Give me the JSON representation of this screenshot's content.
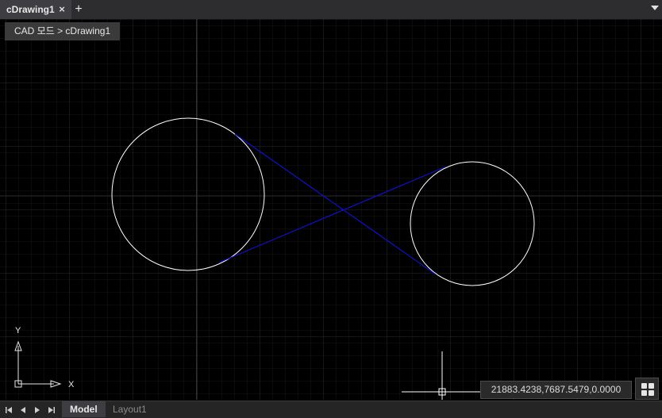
{
  "tab": {
    "title": "cDrawing1",
    "close_glyph": "×",
    "new_glyph": "+"
  },
  "breadcrumb": "CAD 모드 > cDrawing1",
  "axis": {
    "x_label": "X",
    "y_label": "Y"
  },
  "coordinates": "21883.4238,7687.5479,0.0000",
  "layout_tabs": [
    {
      "label": "Model",
      "active": true
    },
    {
      "label": "Layout1",
      "active": false
    }
  ],
  "colors": {
    "background": "#000000",
    "grid": "#1e1e1e",
    "grid_major": "#2c2c2c",
    "circle": "#ffffff",
    "tangent_line": "#1010cc"
  }
}
